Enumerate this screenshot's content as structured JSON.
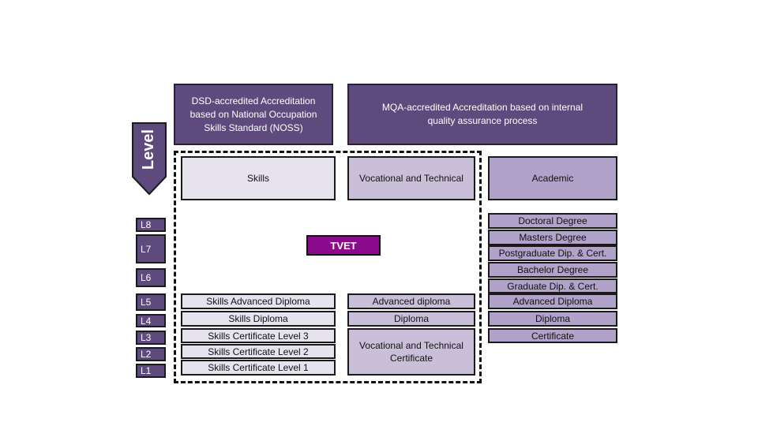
{
  "headers": {
    "dsd": "DSD-accredited Accreditation based on National Occupation Skills Standard (NOSS)",
    "mqa": "MQA-accredited Accreditation based on internal quality assurance process"
  },
  "level_arrow_label": "Level",
  "levels": [
    "L8",
    "L7",
    "L6",
    "L5",
    "L4",
    "L3",
    "L2",
    "L1"
  ],
  "categories": {
    "skills": "Skills",
    "vocational": "Vocational and Technical",
    "academic": "Academic"
  },
  "tvet_label": "TVET",
  "skills_column": [
    "Skills Advanced Diploma",
    "Skills Diploma",
    "Skills Certificate Level 3",
    "Skills Certificate Level 2",
    "Skills Certificate Level 1"
  ],
  "vocational_column": [
    "Advanced diploma",
    "Diploma",
    "Vocational and Technical Certificate"
  ],
  "academic_column": [
    "Doctoral Degree",
    "Masters Degree",
    "Postgraduate Dip. & Cert.",
    "Bachelor Degree",
    "Graduate Dip. & Cert.",
    "Advanced Diploma",
    "Diploma",
    "Certificate"
  ]
}
